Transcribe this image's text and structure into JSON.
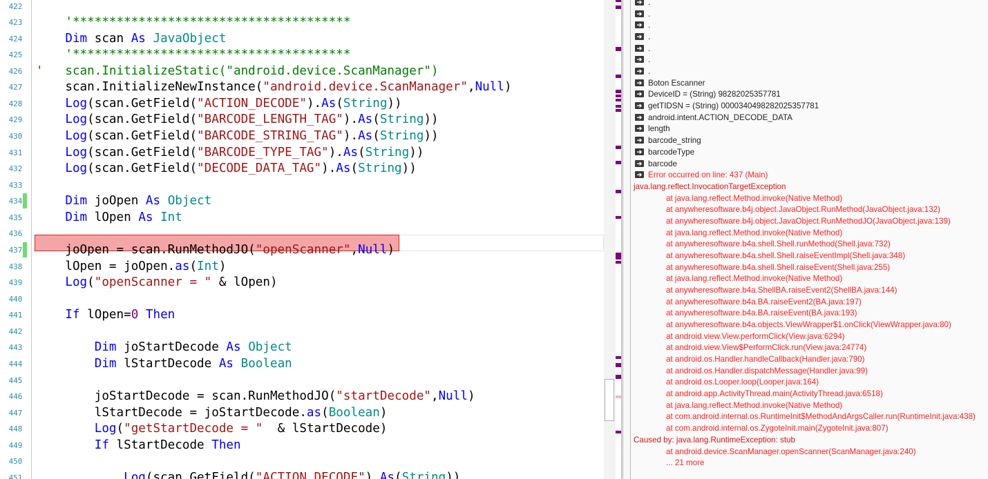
{
  "editor": {
    "first_line_number": 422,
    "error_line_number": 437,
    "changed_lines": [
      434,
      437
    ],
    "colors": {
      "keyword": "#0000ff",
      "type": "#008b8b",
      "string": "#a31515",
      "comment": "#008000",
      "number": "#800080",
      "error_highlight": "#f4a6a6",
      "changed_marker": "#6fdc6f"
    },
    "lines": [
      [],
      [
        [
          "    '**************************************",
          "cm"
        ]
      ],
      [
        [
          "    ",
          "pl"
        ],
        [
          "Dim",
          "kw"
        ],
        [
          " scan ",
          "pl"
        ],
        [
          "As",
          "kw"
        ],
        [
          " ",
          "pl"
        ],
        [
          "JavaObject",
          "ty"
        ]
      ],
      [
        [
          "    '**************************************",
          "cm"
        ]
      ],
      [
        [
          "'   scan.InitializeStatic(\"android.device.ScanManager\")",
          "cm"
        ]
      ],
      [
        [
          "    scan.InitializeNewInstance(",
          "pl"
        ],
        [
          "\"android.device.ScanManager\"",
          "st"
        ],
        [
          ",",
          "pl"
        ],
        [
          "Null",
          "kw"
        ],
        [
          ")",
          "pl"
        ]
      ],
      [
        [
          "    ",
          "pl"
        ],
        [
          "Log",
          "kw"
        ],
        [
          "(scan.GetField(",
          "pl"
        ],
        [
          "\"ACTION_DECODE\"",
          "st"
        ],
        [
          ").",
          "pl"
        ],
        [
          "As",
          "kw"
        ],
        [
          "(",
          "pl"
        ],
        [
          "String",
          "ty"
        ],
        [
          "))",
          "pl"
        ]
      ],
      [
        [
          "    ",
          "pl"
        ],
        [
          "Log",
          "kw"
        ],
        [
          "(scan.GetField(",
          "pl"
        ],
        [
          "\"BARCODE_LENGTH_TAG\"",
          "st"
        ],
        [
          ").",
          "pl"
        ],
        [
          "As",
          "kw"
        ],
        [
          "(",
          "pl"
        ],
        [
          "String",
          "ty"
        ],
        [
          "))",
          "pl"
        ]
      ],
      [
        [
          "    ",
          "pl"
        ],
        [
          "Log",
          "kw"
        ],
        [
          "(scan.GetField(",
          "pl"
        ],
        [
          "\"BARCODE_STRING_TAG\"",
          "st"
        ],
        [
          ").",
          "pl"
        ],
        [
          "As",
          "kw"
        ],
        [
          "(",
          "pl"
        ],
        [
          "String",
          "ty"
        ],
        [
          "))",
          "pl"
        ]
      ],
      [
        [
          "    ",
          "pl"
        ],
        [
          "Log",
          "kw"
        ],
        [
          "(scan.GetField(",
          "pl"
        ],
        [
          "\"BARCODE_TYPE_TAG\"",
          "st"
        ],
        [
          ").",
          "pl"
        ],
        [
          "As",
          "kw"
        ],
        [
          "(",
          "pl"
        ],
        [
          "String",
          "ty"
        ],
        [
          "))",
          "pl"
        ]
      ],
      [
        [
          "    ",
          "pl"
        ],
        [
          "Log",
          "kw"
        ],
        [
          "(scan.GetField(",
          "pl"
        ],
        [
          "\"DECODE_DATA_TAG\"",
          "st"
        ],
        [
          ").",
          "pl"
        ],
        [
          "As",
          "kw"
        ],
        [
          "(",
          "pl"
        ],
        [
          "String",
          "ty"
        ],
        [
          "))",
          "pl"
        ]
      ],
      [],
      [
        [
          "    ",
          "pl"
        ],
        [
          "Dim",
          "kw"
        ],
        [
          " joOpen ",
          "pl"
        ],
        [
          "As",
          "kw"
        ],
        [
          " ",
          "pl"
        ],
        [
          "Object",
          "ty"
        ]
      ],
      [
        [
          "    ",
          "pl"
        ],
        [
          "Dim",
          "kw"
        ],
        [
          " lOpen ",
          "pl"
        ],
        [
          "As",
          "kw"
        ],
        [
          " ",
          "pl"
        ],
        [
          "Int",
          "ty"
        ]
      ],
      [],
      [
        [
          "    joOpen = scan.RunMethodJO(",
          "pl"
        ],
        [
          "\"openScanner\"",
          "st"
        ],
        [
          ",",
          "pl"
        ],
        [
          "Null",
          "kw"
        ],
        [
          ")",
          "pl"
        ]
      ],
      [
        [
          "    lOpen = joOpen.",
          "pl"
        ],
        [
          "as",
          "kw"
        ],
        [
          "(",
          "pl"
        ],
        [
          "Int",
          "ty"
        ],
        [
          ")",
          "pl"
        ]
      ],
      [
        [
          "    ",
          "pl"
        ],
        [
          "Log",
          "kw"
        ],
        [
          "(",
          "pl"
        ],
        [
          "\"openScanner = \"",
          "st"
        ],
        [
          " & lOpen)",
          "pl"
        ]
      ],
      [],
      [
        [
          "    ",
          "pl"
        ],
        [
          "If",
          "kw"
        ],
        [
          " lOpen=",
          "pl"
        ],
        [
          "0",
          "nu"
        ],
        [
          " ",
          "pl"
        ],
        [
          "Then",
          "kw"
        ]
      ],
      [],
      [
        [
          "        ",
          "pl"
        ],
        [
          "Dim",
          "kw"
        ],
        [
          " joStartDecode ",
          "pl"
        ],
        [
          "As",
          "kw"
        ],
        [
          " ",
          "pl"
        ],
        [
          "Object",
          "ty"
        ]
      ],
      [
        [
          "        ",
          "pl"
        ],
        [
          "Dim",
          "kw"
        ],
        [
          " lStartDecode ",
          "pl"
        ],
        [
          "As",
          "kw"
        ],
        [
          " ",
          "pl"
        ],
        [
          "Boolean",
          "ty"
        ]
      ],
      [],
      [
        [
          "        joStartDecode = scan.RunMethodJO(",
          "pl"
        ],
        [
          "\"startDecode\"",
          "st"
        ],
        [
          ",",
          "pl"
        ],
        [
          "Null",
          "kw"
        ],
        [
          ")",
          "pl"
        ]
      ],
      [
        [
          "        lStartDecode = joStartDecode.",
          "pl"
        ],
        [
          "as",
          "kw"
        ],
        [
          "(",
          "pl"
        ],
        [
          "Boolean",
          "ty"
        ],
        [
          ")",
          "pl"
        ]
      ],
      [
        [
          "        ",
          "pl"
        ],
        [
          "Log",
          "kw"
        ],
        [
          "(",
          "pl"
        ],
        [
          "\"getStartDecode = \"",
          "st"
        ],
        [
          "  & lStartDecode)",
          "pl"
        ]
      ],
      [
        [
          "        ",
          "pl"
        ],
        [
          "If",
          "kw"
        ],
        [
          " lStartDecode ",
          "pl"
        ],
        [
          "Then",
          "kw"
        ]
      ],
      [],
      [
        [
          "            ",
          "pl"
        ],
        [
          "Log",
          "kw"
        ],
        [
          "(scan.GetField(",
          "pl"
        ],
        [
          "\"ACTION_DECODE\"",
          "st"
        ],
        [
          ").",
          "pl"
        ],
        [
          "As",
          "kw"
        ],
        [
          "(",
          "pl"
        ],
        [
          "String",
          "ty"
        ],
        [
          "))",
          "pl"
        ]
      ]
    ]
  },
  "log": {
    "icon": "arrow-right-icon",
    "colors": {
      "error": "#ff2020",
      "info": "#222222"
    },
    "entries": [
      {
        "kind": "info",
        "text": "."
      },
      {
        "kind": "info",
        "text": "."
      },
      {
        "kind": "info",
        "text": "."
      },
      {
        "kind": "info",
        "text": "."
      },
      {
        "kind": "info",
        "text": "."
      },
      {
        "kind": "info",
        "text": "."
      },
      {
        "kind": "info",
        "text": "."
      },
      {
        "kind": "info",
        "text": "Boton Escanner"
      },
      {
        "kind": "info",
        "text": "DeviceID = (String) 98282025357781"
      },
      {
        "kind": "info",
        "text": "getTIDSN = (String) 0000340498282025357781"
      },
      {
        "kind": "info",
        "text": "android.intent.ACTION_DECODE_DATA"
      },
      {
        "kind": "info",
        "text": "length"
      },
      {
        "kind": "info",
        "text": "barcode_string"
      },
      {
        "kind": "info",
        "text": "barcodeType"
      },
      {
        "kind": "info",
        "text": "barcode"
      },
      {
        "kind": "error",
        "text": "Error occurred on line: 437 (Main)"
      },
      {
        "kind": "exc",
        "text": "java.lang.reflect.InvocationTargetException"
      },
      {
        "kind": "trace",
        "text": "at java.lang.reflect.Method.invoke(Native Method)"
      },
      {
        "kind": "trace",
        "text": "at anywheresoftware.b4j.object.JavaObject.RunMethod(JavaObject.java:132)"
      },
      {
        "kind": "trace",
        "text": "at anywheresoftware.b4j.object.JavaObject.RunMethodJO(JavaObject.java:139)"
      },
      {
        "kind": "trace",
        "text": "at java.lang.reflect.Method.invoke(Native Method)"
      },
      {
        "kind": "trace",
        "text": "at anywheresoftware.b4a.shell.Shell.runMethod(Shell.java:732)"
      },
      {
        "kind": "trace",
        "text": "at anywheresoftware.b4a.shell.Shell.raiseEventImpl(Shell.java:348)"
      },
      {
        "kind": "trace",
        "text": "at anywheresoftware.b4a.shell.Shell.raiseEvent(Shell.java:255)"
      },
      {
        "kind": "trace",
        "text": "at java.lang.reflect.Method.invoke(Native Method)"
      },
      {
        "kind": "trace",
        "text": "at anywheresoftware.b4a.ShellBA.raiseEvent2(ShellBA.java:144)"
      },
      {
        "kind": "trace",
        "text": "at anywheresoftware.b4a.BA.raiseEvent2(BA.java:197)"
      },
      {
        "kind": "trace",
        "text": "at anywheresoftware.b4a.BA.raiseEvent(BA.java:193)"
      },
      {
        "kind": "trace",
        "text": "at anywheresoftware.b4a.objects.ViewWrapper$1.onClick(ViewWrapper.java:80)"
      },
      {
        "kind": "trace",
        "text": "at android.view.View.performClick(View.java:6294)"
      },
      {
        "kind": "trace",
        "text": "at android.view.View$PerformClick.run(View.java:24774)"
      },
      {
        "kind": "trace",
        "text": "at android.os.Handler.handleCallback(Handler.java:790)"
      },
      {
        "kind": "trace",
        "text": "at android.os.Handler.dispatchMessage(Handler.java:99)"
      },
      {
        "kind": "trace",
        "text": "at android.os.Looper.loop(Looper.java:164)"
      },
      {
        "kind": "trace",
        "text": "at android.app.ActivityThread.main(ActivityThread.java:6518)"
      },
      {
        "kind": "trace",
        "text": "at java.lang.reflect.Method.invoke(Native Method)"
      },
      {
        "kind": "trace",
        "text": "at com.android.internal.os.RuntimeInit$MethodAndArgsCaller.run(RuntimeInit.java:438)"
      },
      {
        "kind": "trace",
        "text": "at com.android.internal.os.ZygoteInit.main(ZygoteInit.java:807)"
      },
      {
        "kind": "exc",
        "text": "Caused by: java.lang.RuntimeException: stub"
      },
      {
        "kind": "trace",
        "text": "at android.device.ScanManager.openScanner(ScanManager.java:240)"
      },
      {
        "kind": "trace",
        "text": "... 21 more"
      }
    ]
  }
}
